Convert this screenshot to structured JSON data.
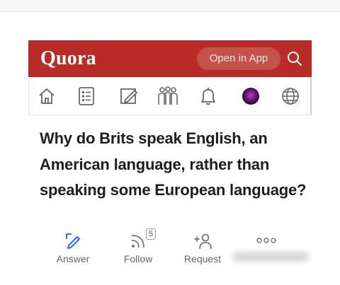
{
  "header": {
    "logo": "Quora",
    "open_app_label": "Open in App",
    "brand_color": "#b92b27"
  },
  "nav": {
    "items": [
      "home-icon",
      "answers-list-icon",
      "write-icon",
      "spaces-icon",
      "notifications-icon",
      "profile-avatar",
      "languages-globe-icon"
    ]
  },
  "question": {
    "title": "Why do Brits speak English, an American language, rather than speaking some European language?"
  },
  "actions": {
    "answer_label": "Answer",
    "follow_label": "Follow",
    "follow_count": "5",
    "request_label": "Request",
    "more_icon": "more-dots-icon"
  },
  "colors": {
    "answer_icon": "#2e69ff",
    "text_dark": "#1e1e1e",
    "text_muted": "#666666"
  }
}
